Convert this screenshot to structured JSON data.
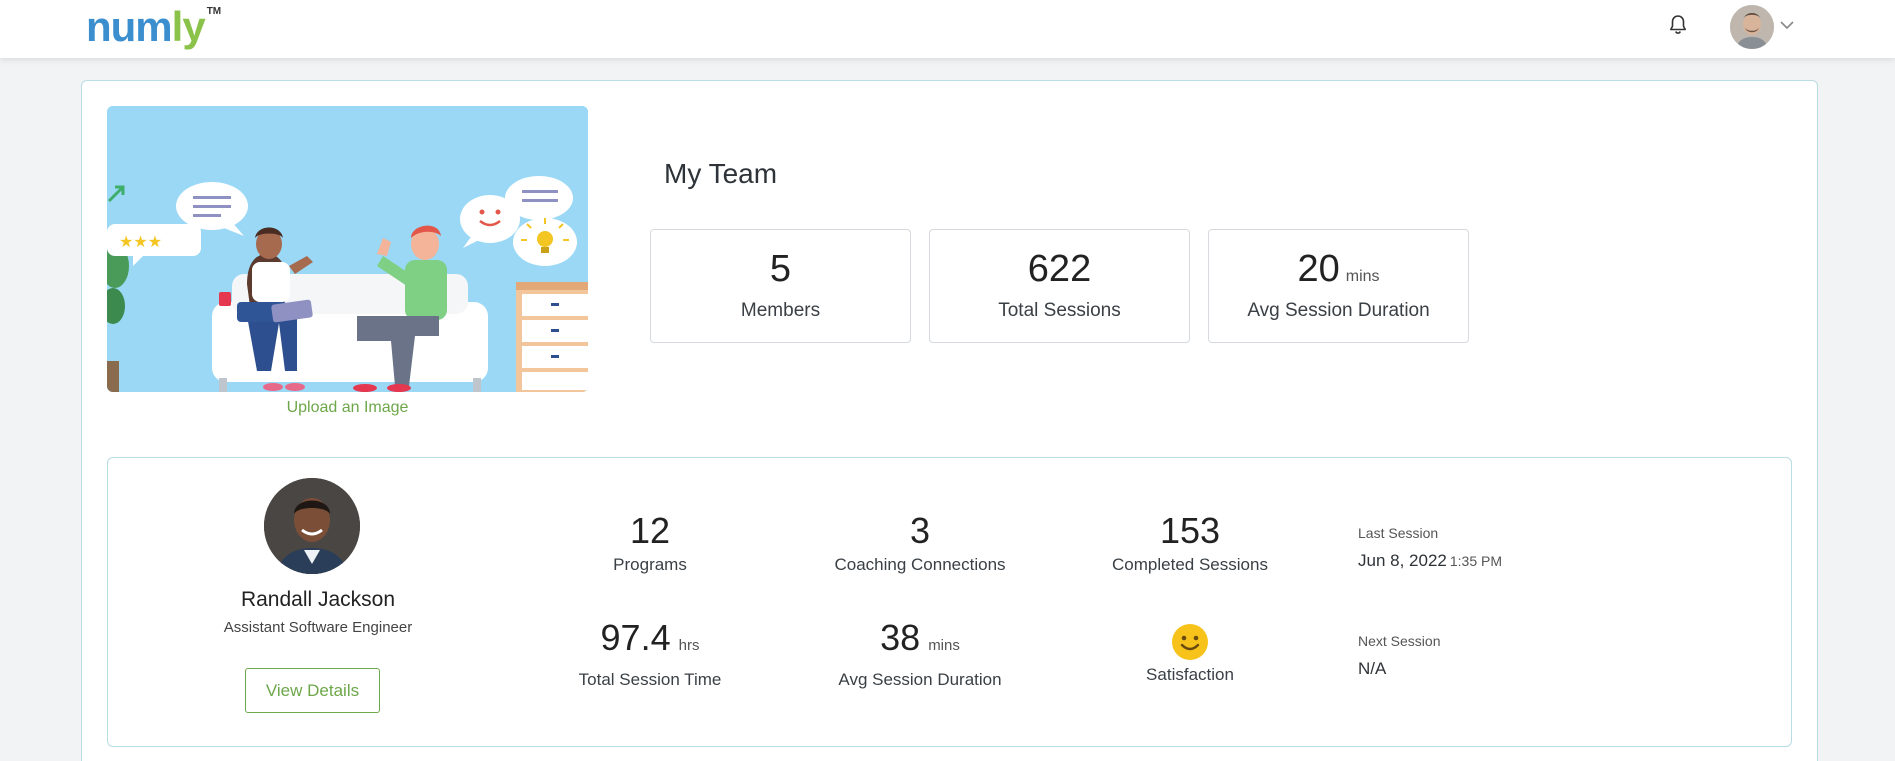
{
  "header": {
    "logo_part1": "num",
    "logo_part2": "ly",
    "logo_tm": "TM",
    "icons": [
      "bell-icon",
      "avatar",
      "chevron-down-icon"
    ]
  },
  "team": {
    "upload_label": "Upload an Image",
    "title": "My Team",
    "stats": [
      {
        "value": "5",
        "unit": "",
        "label": "Members"
      },
      {
        "value": "622",
        "unit": "",
        "label": "Total Sessions"
      },
      {
        "value": "20",
        "unit": "mins",
        "label": "Avg Session Duration"
      }
    ]
  },
  "member": {
    "name": "Randall Jackson",
    "role": "Assistant Software Engineer",
    "view_details": "View Details",
    "stats": {
      "programs": {
        "value": "12",
        "label": "Programs"
      },
      "coaching": {
        "value": "3",
        "label": "Coaching Connections"
      },
      "completed": {
        "value": "153",
        "label": "Completed Sessions"
      },
      "total_time": {
        "value": "97.4",
        "unit": "hrs",
        "label": "Total Session Time"
      },
      "avg_duration": {
        "value": "38",
        "unit": "mins",
        "label": "Avg Session Duration"
      },
      "satisfaction": {
        "label": "Satisfaction",
        "icon": "smiley-icon"
      }
    },
    "last_session": {
      "label": "Last Session",
      "date": "Jun 8, 2022",
      "time": "1:35 PM"
    },
    "next_session": {
      "label": "Next Session",
      "value": "N/A"
    }
  },
  "colors": {
    "accent_green": "#6da74a",
    "logo_blue": "#3c8fcf",
    "logo_green": "#8bc34a",
    "border_teal": "#b9dde4",
    "smiley_yellow": "#f7c21a"
  }
}
